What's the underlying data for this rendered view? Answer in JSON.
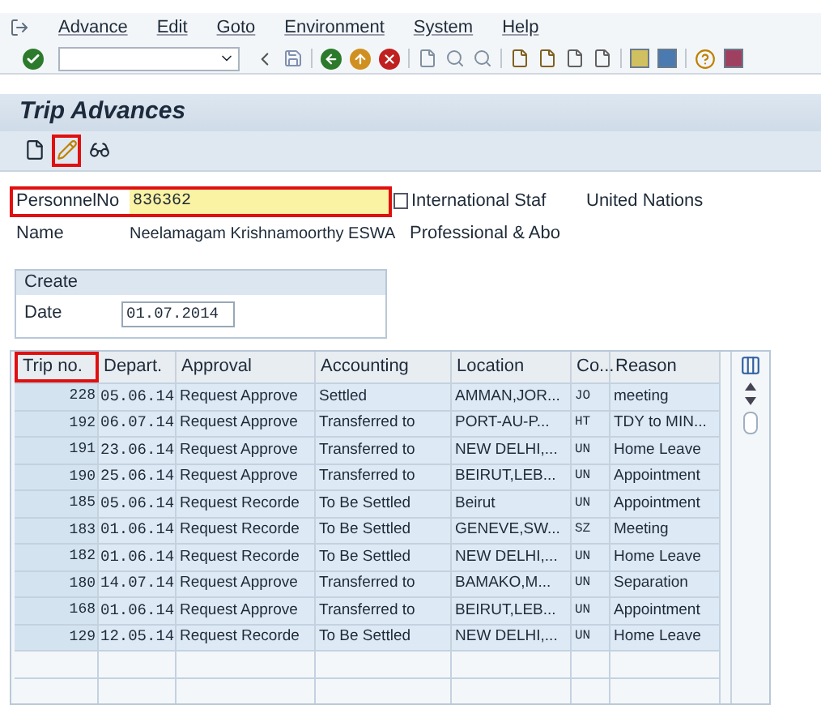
{
  "menu": [
    "Advance",
    "Edit",
    "Goto",
    "Environment",
    "System",
    "Help"
  ],
  "title": "Trip Advances",
  "app_toolbar": [
    {
      "kind": "new",
      "highlighted": false
    },
    {
      "kind": "edit",
      "highlighted": true
    },
    {
      "kind": "glasses",
      "highlighted": false
    }
  ],
  "personnel": {
    "label": "PersonnelNo",
    "value": "836362",
    "highlighted": true,
    "staff_type": "International Staf",
    "organization": "United Nations"
  },
  "name": {
    "label": "Name",
    "value": "Neelamagam Krishnamoorthy ESWA",
    "grade": "Professional & Abo"
  },
  "create": {
    "title": "Create",
    "date_label": "Date",
    "date_value": "01.07.2014"
  },
  "table": {
    "columns": [
      {
        "label": "Trip no.",
        "highlighted": true
      },
      {
        "label": "Depart.",
        "highlighted": false
      },
      {
        "label": "Approval",
        "highlighted": false
      },
      {
        "label": "Accounting",
        "highlighted": false
      },
      {
        "label": "Location",
        "highlighted": false
      },
      {
        "label": "Co...",
        "highlighted": false
      },
      {
        "label": "Reason",
        "highlighted": false
      }
    ],
    "rows": [
      [
        "228",
        "05.06.14",
        "Request Approve",
        "Settled",
        "AMMAN,JOR...",
        "JO",
        "meeting"
      ],
      [
        "192",
        "06.07.14",
        "Request Approve",
        "Transferred to",
        "PORT-AU-P...",
        "HT",
        "TDY to MIN..."
      ],
      [
        "191",
        "23.06.14",
        "Request Approve",
        "Transferred to",
        "NEW DELHI,...",
        "UN",
        "Home Leave"
      ],
      [
        "190",
        "25.06.14",
        "Request Approve",
        "Transferred to",
        "BEIRUT,LEB...",
        "UN",
        "Appointment"
      ],
      [
        "185",
        "05.06.14",
        "Request Recorde",
        "To Be Settled",
        "Beirut",
        "UN",
        "Appointment"
      ],
      [
        "183",
        "01.06.14",
        "Request Recorde",
        "To Be Settled",
        "GENEVE,SW...",
        "SZ",
        "Meeting"
      ],
      [
        "182",
        "01.06.14",
        "Request Recorde",
        "To Be Settled",
        "NEW DELHI,...",
        "UN",
        "Home Leave"
      ],
      [
        "180",
        "14.07.14",
        "Request Approve",
        "Transferred to",
        "BAMAKO,M...",
        "UN",
        "Separation"
      ],
      [
        "168",
        "01.06.14",
        "Request Approve",
        "Transferred to",
        "BEIRUT,LEB...",
        "UN",
        "Appointment"
      ],
      [
        "129",
        "12.05.14",
        "Request Recorde",
        "To Be Settled",
        "NEW DELHI,...",
        "UN",
        "Home Leave"
      ]
    ]
  }
}
